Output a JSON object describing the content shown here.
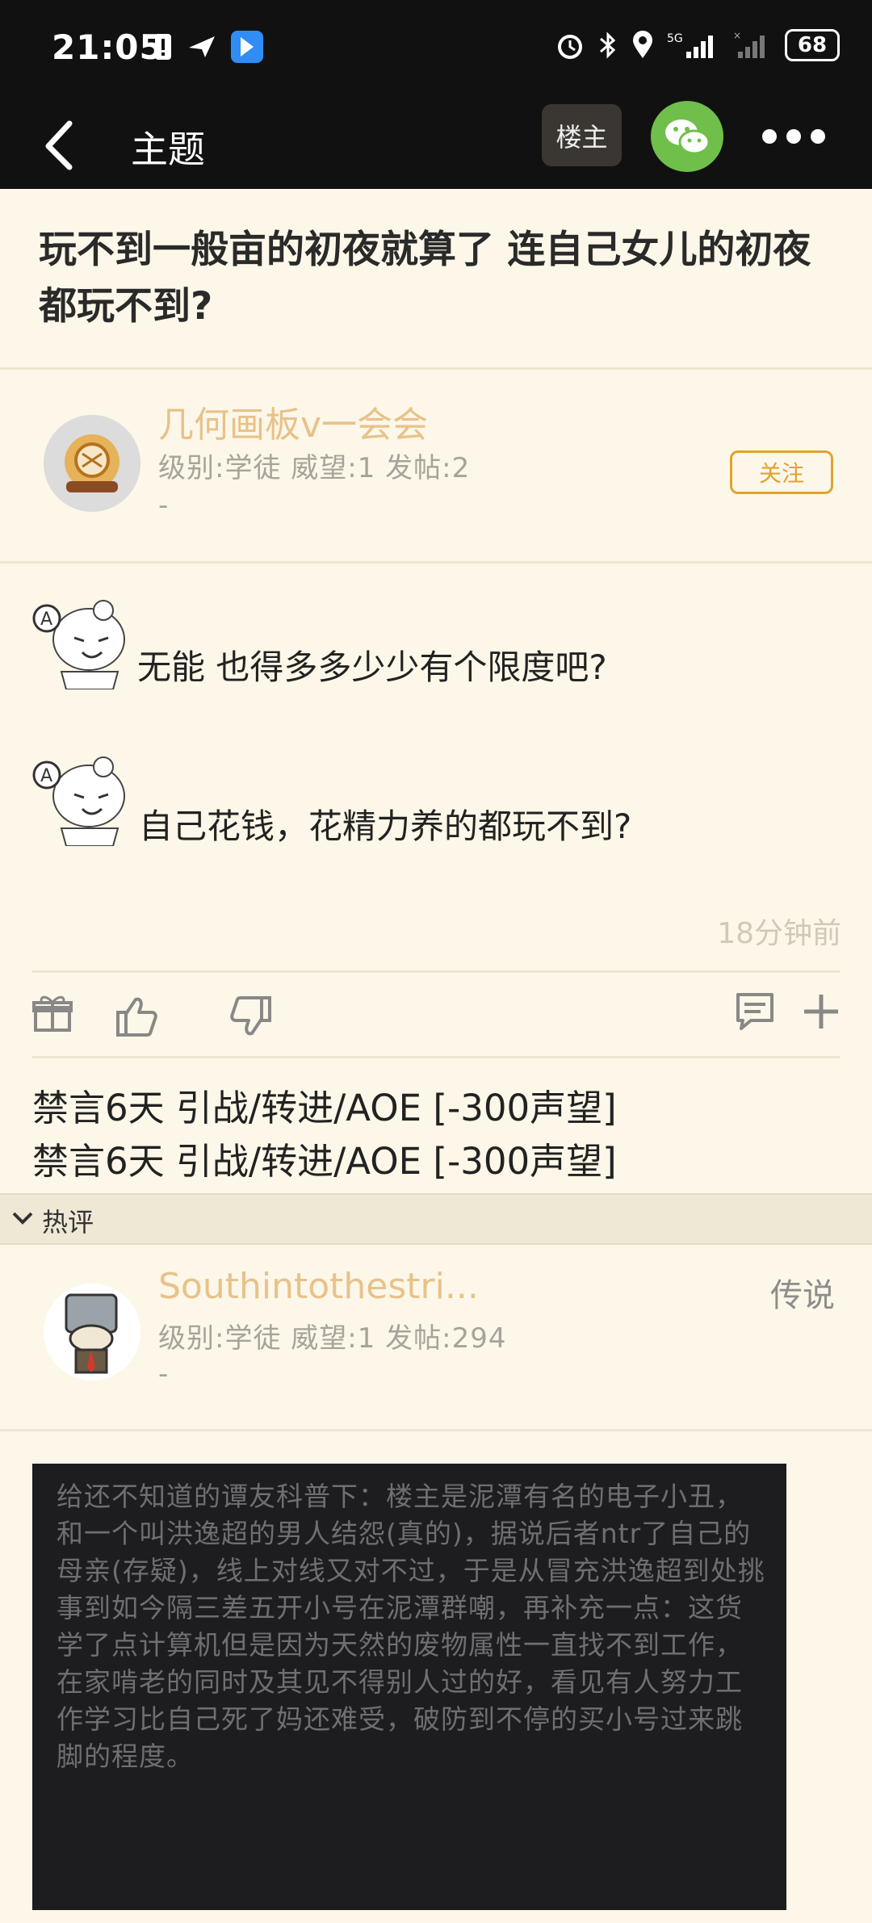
{
  "status": {
    "time": "21:05",
    "battery": "68",
    "network": "5G"
  },
  "appbar": {
    "title": "主题",
    "op_label": "楼主"
  },
  "topic": {
    "title": "玩不到一般亩的初夜就算了 连自己女儿的初夜都玩不到?"
  },
  "author": {
    "name": "几何画板v一会会",
    "meta": "级别:学徒 威望:1 发帖:2",
    "dash": "-",
    "follow_label": "关注"
  },
  "post": {
    "lines": [
      "无能 也得多多少少有个限度吧?",
      "自己花钱，花精力养的都玩不到?"
    ],
    "time": "18分钟前"
  },
  "penalties": [
    "禁言6天 引战/转进/AOE [-300声望]",
    "禁言6天 引战/转进/AOE [-300声望]"
  ],
  "hot": {
    "label": "热评"
  },
  "reply": {
    "name": "Southintothestri...",
    "meta": "级别:学徒 威望:1 发帖:294",
    "dash": "-",
    "badge": "传说",
    "quote": "给还不知道的谭友科普下：楼主是泥潭有名的电子小丑，和一个叫洪逸超的男人结怨(真的)，据说后者ntr了自己的母亲(存疑)，线上对线又对不过，于是从冒充洪逸超到处挑事到如今隔三差五开小号在泥潭群嘲，再补充一点：这货学了点计算机但是因为天然的废物属性一直找不到工作，在家啃老的同时及其见不得别人过的好，看见有人努力工作学习比自己死了妈还难受，破防到不停的买小号过来跳脚的程度。"
  },
  "colors": {
    "background": "#fcf7e8",
    "username": "#e8c28a",
    "follow": "#e0a330",
    "appbar": "#111111"
  }
}
